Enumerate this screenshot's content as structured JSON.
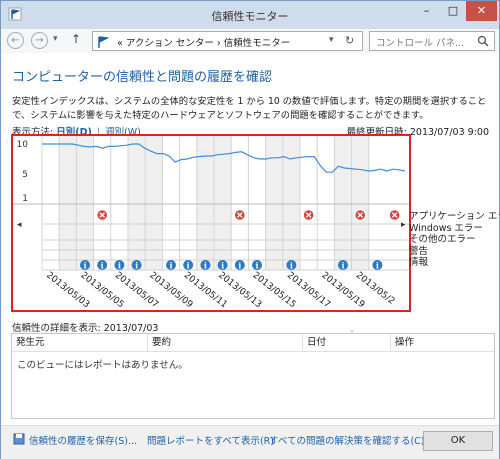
{
  "window": {
    "title": "信頼性モニター",
    "minimize_label": "–",
    "maximize_label": "□",
    "close_label": "✕",
    "accent_color": "#1e5fa8",
    "highlight_color": "#e2201c"
  },
  "nav": {
    "back_label": "←",
    "forward_label": "→",
    "recent_label": "▾",
    "up_label": "↑",
    "address_path": "«  アクション センター  ›  信頼性モニター",
    "address_dropdown": "▾",
    "refresh_label": "↻",
    "search_placeholder": "コントロール パネ..."
  },
  "main": {
    "heading": "コンピューターの信頼性と問題の履歴を確認",
    "description": "安定性インデックスは、システムの全体的な安定性を 1 から 10 の数値で評価します。特定の期間を選択することで、システムに影響を与えた特定のハードウェアとソフトウェアの問題を確認することができます。",
    "view_label": "表示方法:",
    "view_daily": "日別(D)",
    "view_separator": "|",
    "view_weekly": "週別(W)",
    "last_updated": "最終更新日時: 2013/07/03 9:00"
  },
  "chart_data": {
    "type": "line",
    "title": "",
    "ylim": [
      1,
      10
    ],
    "y_ticks": [
      "10",
      "5",
      "1"
    ],
    "x_labels": [
      "2013/05/03",
      "2013/05/05",
      "2013/05/07",
      "2013/05/09",
      "2013/05/11",
      "2013/05/13",
      "2013/05/15",
      "2013/05/17",
      "2013/05/19",
      "2013/05/2"
    ],
    "stability_index": [
      10,
      10,
      10,
      10,
      10,
      10,
      9.8,
      9.6,
      9.5,
      9.6,
      9.3,
      9.6,
      9.6,
      9.7,
      9.8,
      10,
      10,
      9.3,
      8.8,
      8.4,
      8.4,
      8.0,
      7.0,
      7.4,
      7.5,
      7.8,
      7.9,
      8.0,
      8.0,
      8.2,
      8.3,
      8.4,
      8.6,
      8.7,
      8.2,
      7.7,
      7.5,
      7.5,
      7.7,
      7.7,
      7.9,
      7.5,
      7.7,
      7.8,
      7.9,
      7.9,
      6.4,
      5.3,
      5.3,
      6.3,
      6.0,
      5.9,
      5.8,
      5.7,
      5.5,
      5.6,
      5.8,
      5.5,
      5.8,
      5.7,
      5.5
    ],
    "rows": [
      "アプリケーション エラー",
      "Windows エラー",
      "その他のエラー",
      "警告",
      "情報"
    ],
    "app_error_days": [
      3,
      11,
      15,
      18,
      20
    ],
    "info_days": [
      2,
      3,
      4,
      5,
      7,
      8,
      9,
      10,
      11,
      12,
      14,
      17,
      19
    ],
    "scroll_left": "◂",
    "scroll_right": "▸"
  },
  "details": {
    "title": "信頼性の詳細を表示: 2013/07/03",
    "columns": [
      "発生元",
      "要約",
      "日付",
      "操作"
    ],
    "sort_indicator": "ˆ",
    "empty_message": "このビューにはレポートはありません。"
  },
  "footer": {
    "save_history": "信頼性の履歴を保存(S)...",
    "view_all_reports": "問題レポートをすべて表示(R)",
    "check_solutions": "すべての問題の解決策を確認する(C)...",
    "ok_label": "OK"
  }
}
